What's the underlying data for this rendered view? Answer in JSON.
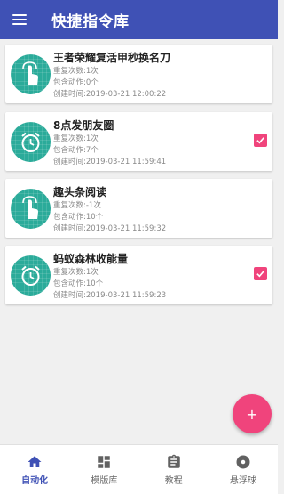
{
  "appbar": {
    "title": "快捷指令库",
    "menu_icon": "hamburger-menu-icon"
  },
  "tasks": [
    {
      "title": "王者荣耀复活甲秒换名刀",
      "repeat": "重复次数:1次",
      "actions": "包含动作:0个",
      "created": "创建时间:2019-03-21 12:00:22",
      "icon": "touch-icon",
      "checked": false
    },
    {
      "title": "8点发朋友圈",
      "repeat": "重复次数:1次",
      "actions": "包含动作:7个",
      "created": "创建时间:2019-03-21 11:59:41",
      "icon": "alarm-clock-icon",
      "checked": true
    },
    {
      "title": "趣头条阅读",
      "repeat": "重复次数:-1次",
      "actions": "包含动作:10个",
      "created": "创建时间:2019-03-21 11:59:32",
      "icon": "touch-icon",
      "checked": false
    },
    {
      "title": "蚂蚁森林收能量",
      "repeat": "重复次数:1次",
      "actions": "包含动作:10个",
      "created": "创建时间:2019-03-21 11:59:23",
      "icon": "alarm-clock-icon",
      "checked": true
    }
  ],
  "fab": {
    "label": "+"
  },
  "bottom_nav": [
    {
      "label": "自动化",
      "icon": "home-icon",
      "active": true
    },
    {
      "label": "模版库",
      "icon": "dashboard-icon",
      "active": false
    },
    {
      "label": "教程",
      "icon": "clipboard-icon",
      "active": false
    },
    {
      "label": "悬浮球",
      "icon": "disc-icon",
      "active": false
    }
  ],
  "colors": {
    "primary": "#3f51b5",
    "accent": "#f0447c",
    "avatar": "#2bab9a"
  }
}
